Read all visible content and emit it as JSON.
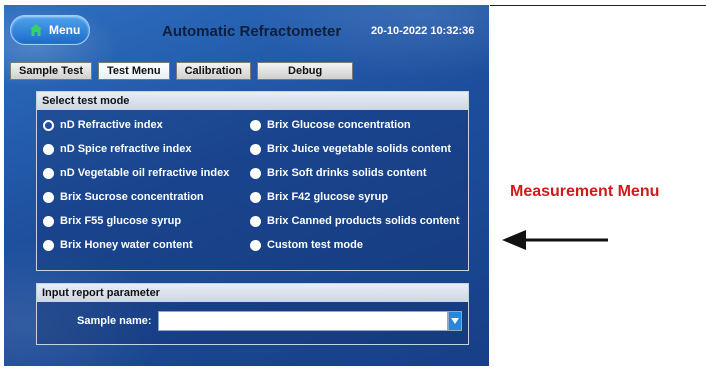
{
  "header": {
    "menu_label": "Menu",
    "title": "Automatic Refractometer",
    "datetime": "20-10-2022 10:32:36"
  },
  "tabs": [
    {
      "label": "Sample Test"
    },
    {
      "label": "Test Menu",
      "active": true
    },
    {
      "label": "Calibration"
    },
    {
      "label": "Debug"
    }
  ],
  "test_mode": {
    "heading": "Select test mode",
    "selected_index": 0,
    "left": [
      "nD Refractive index",
      "nD Spice refractive index",
      "nD Vegetable oil refractive index",
      "Brix Sucrose concentration",
      "Brix F55 glucose syrup",
      "Brix Honey water content"
    ],
    "right": [
      "Brix Glucose concentration",
      "Brix Juice vegetable solids content",
      "Brix Soft drinks solids content",
      "Brix F42 glucose syrup",
      "Brix Canned products solids content",
      "Custom test mode"
    ]
  },
  "report": {
    "heading": "Input report parameter",
    "sample_label": "Sample name:",
    "sample_value": ""
  },
  "annotation": {
    "label": "Measurement Menu",
    "color": "#d11a1a"
  },
  "icons": {
    "home": "home-icon",
    "dropdown": "chevron-down-icon",
    "arrow": "left-arrow-icon"
  }
}
